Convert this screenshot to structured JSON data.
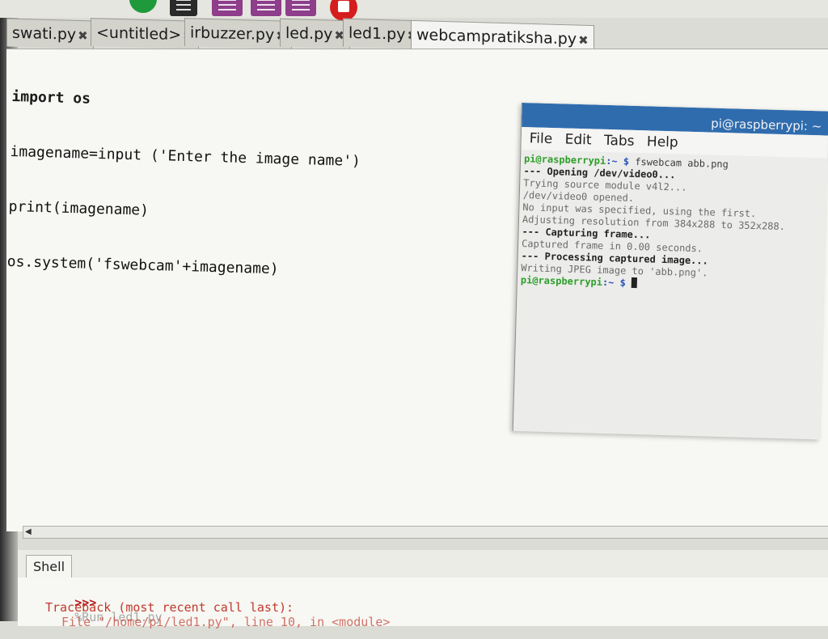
{
  "tabs": [
    {
      "label": "swati.py",
      "close": "✖"
    },
    {
      "label": "<untitled>",
      "close": "✖"
    },
    {
      "label": "irbuzzer.py",
      "close": "✖"
    },
    {
      "label": "led.py",
      "close": "✖"
    },
    {
      "label": "led1.py",
      "close": "✖"
    },
    {
      "label": "webcampratiksha.py",
      "close": "✖"
    }
  ],
  "editor": {
    "lines": [
      "import os",
      "imagename=input ('Enter the image name')",
      "print(imagename)",
      "os.system('fswebcam'+imagename)"
    ]
  },
  "terminal": {
    "title": "pi@raspberrypi: ~",
    "menu": [
      "File",
      "Edit",
      "Tabs",
      "Help"
    ],
    "prompt_user": "pi@raspberrypi",
    "prompt_rest": ":~ $ ",
    "command": "fswebcam abb.png",
    "output": [
      "--- Opening /dev/video0...",
      "Trying source module v4l2...",
      "/dev/video0 opened.",
      "No input was specified, using the first.",
      "Adjusting resolution from 384x288 to 352x288.",
      "--- Capturing frame...",
      "Captured frame in 0.00 seconds.",
      "--- Processing captured image...",
      "Writing JPEG image to 'abb.png'."
    ],
    "final_prompt_user": "pi@raspberrypi",
    "final_prompt_rest": ":~ $ "
  },
  "shell": {
    "tab_label": "Shell",
    "prompt": ">>>",
    "run_cmd": "%Run led1.py",
    "traceback": "Traceback (most recent call last):",
    "file_line": "File \"/home/pi/led1.py\", line 10, in <module>"
  },
  "colors": {
    "terminal_title_bg": "#2f6cae",
    "prompt_green": "#2e9e2a",
    "stop_red": "#d51d1d",
    "run_green": "#1e9a3c"
  }
}
